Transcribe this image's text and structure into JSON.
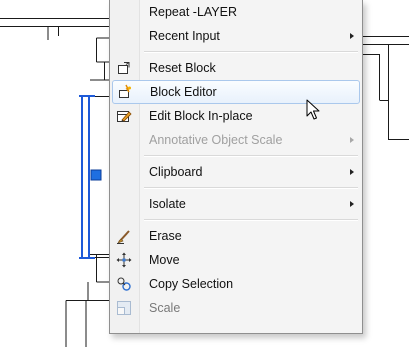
{
  "menu": {
    "items": [
      {
        "label": "Repeat -LAYER",
        "icon": "",
        "submenu": false,
        "disabled": false,
        "hover": false
      },
      {
        "label": "Recent Input",
        "icon": "",
        "submenu": true,
        "disabled": false,
        "hover": false
      },
      {
        "separator": true
      },
      {
        "label": "Reset Block",
        "icon": "reset-block-icon",
        "submenu": false,
        "disabled": false,
        "hover": false
      },
      {
        "label": "Block Editor",
        "icon": "block-editor-icon",
        "submenu": false,
        "disabled": false,
        "hover": true
      },
      {
        "label": "Edit Block In-place",
        "icon": "edit-block-in-place-icon",
        "submenu": false,
        "disabled": false,
        "hover": false
      },
      {
        "label": "Annotative Object Scale",
        "icon": "",
        "submenu": true,
        "disabled": true,
        "hover": false
      },
      {
        "separator": true
      },
      {
        "label": "Clipboard",
        "icon": "",
        "submenu": true,
        "disabled": false,
        "hover": false
      },
      {
        "separator": true
      },
      {
        "label": "Isolate",
        "icon": "",
        "submenu": true,
        "disabled": false,
        "hover": false
      },
      {
        "separator": true
      },
      {
        "label": "Erase",
        "icon": "erase-icon",
        "submenu": false,
        "disabled": false,
        "hover": false
      },
      {
        "label": "Move",
        "icon": "move-icon",
        "submenu": false,
        "disabled": false,
        "hover": false
      },
      {
        "label": "Copy Selection",
        "icon": "copy-selection-icon",
        "submenu": false,
        "disabled": false,
        "hover": false
      },
      {
        "label": "Scale",
        "icon": "scale-icon",
        "submenu": false,
        "disabled": false,
        "hover": false
      }
    ]
  },
  "colors": {
    "selection_blue": "#1e5ad8",
    "grip_fill": "#1f6fe0",
    "hover_border": "#aac8ec",
    "disabled_text": "#a0a0a0"
  }
}
